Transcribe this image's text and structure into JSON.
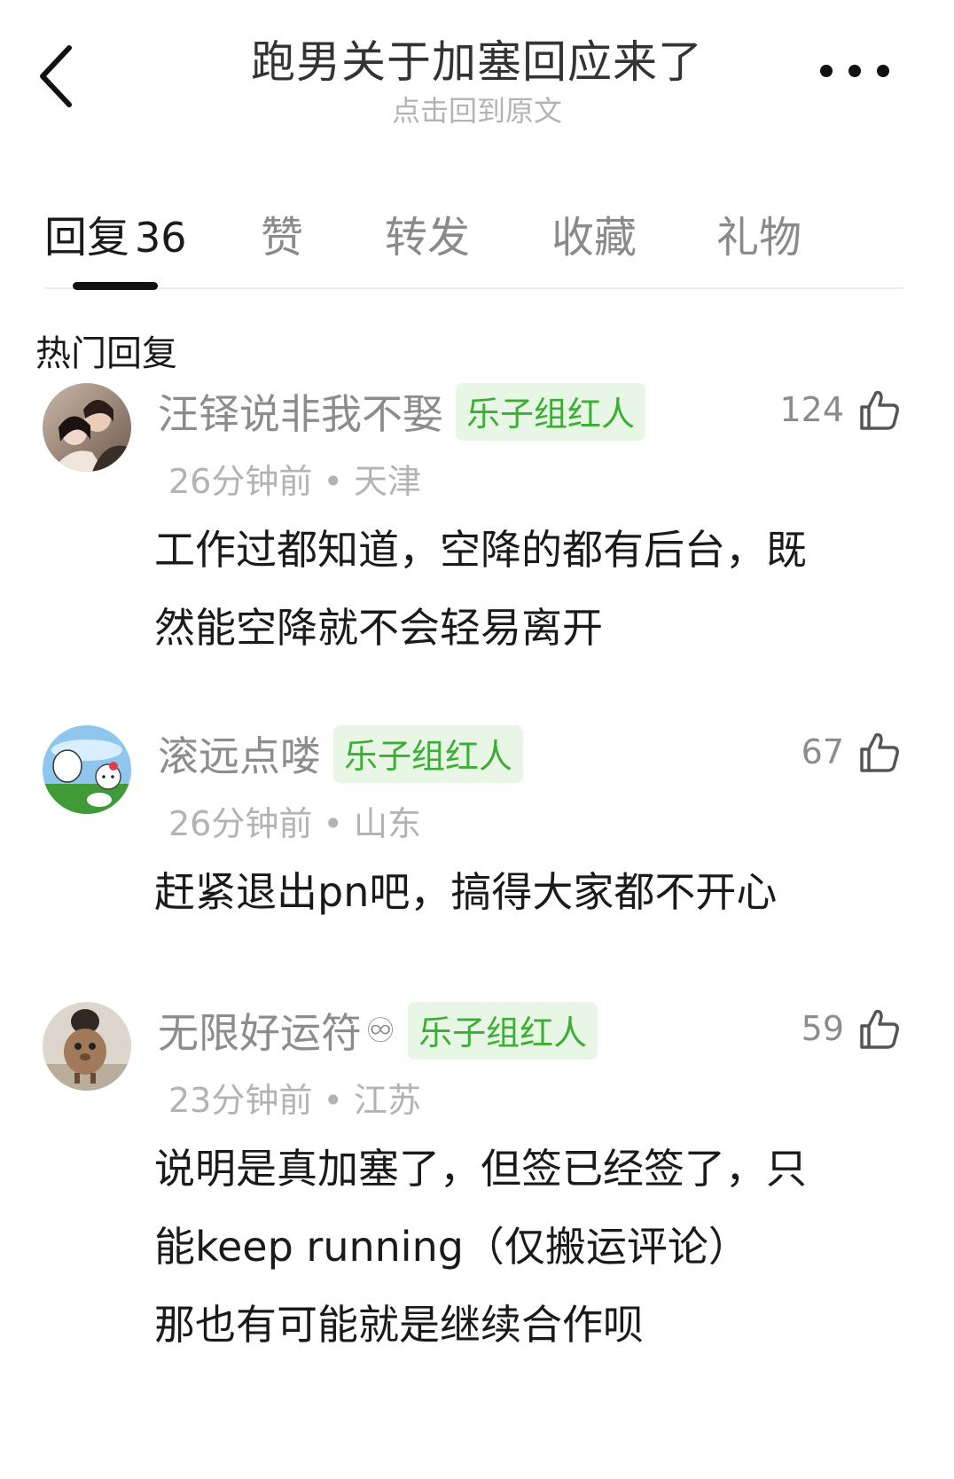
{
  "header": {
    "title": "跑男关于加塞回应来了",
    "subtitle": "点击回到原文"
  },
  "tabs": [
    {
      "label": "回复",
      "count": "36"
    },
    {
      "label": "赞"
    },
    {
      "label": "转发"
    },
    {
      "label": "收藏"
    },
    {
      "label": "礼物"
    }
  ],
  "section_title": "热门回复",
  "comments": [
    {
      "username": "汪铎说非我不娶",
      "badge": "乐子组红人",
      "likes": "124",
      "time": "26分钟前",
      "location": "天津",
      "lines": [
        "工作过都知道，空降的都有后台，既",
        "然能空降就不会轻易离开"
      ]
    },
    {
      "username": "滚远点喽",
      "badge": "乐子组红人",
      "likes": "67",
      "time": "26分钟前",
      "location": "山东",
      "lines": [
        "赶紧退出pn吧，搞得大家都不开心"
      ]
    },
    {
      "username": "无限好运符",
      "username_suffix": "♾",
      "badge": "乐子组红人",
      "likes": "59",
      "time": "23分钟前",
      "location": "江苏",
      "lines": [
        "说明是真加塞了，但签已经签了，只",
        "能keep running（仅搬运评论）",
        "那也有可能就是继续合作呗"
      ]
    }
  ],
  "meta_separator": " • ",
  "colors": {
    "badge_bg": "#e8f7e5",
    "badge_text": "#3dae35",
    "secondary_text": "#8c8c8c",
    "tertiary_text": "#b3b3b3"
  },
  "icons": {
    "back": "chevron-left-icon",
    "more": "more-dots-icon",
    "like": "thumbs-up-icon"
  }
}
